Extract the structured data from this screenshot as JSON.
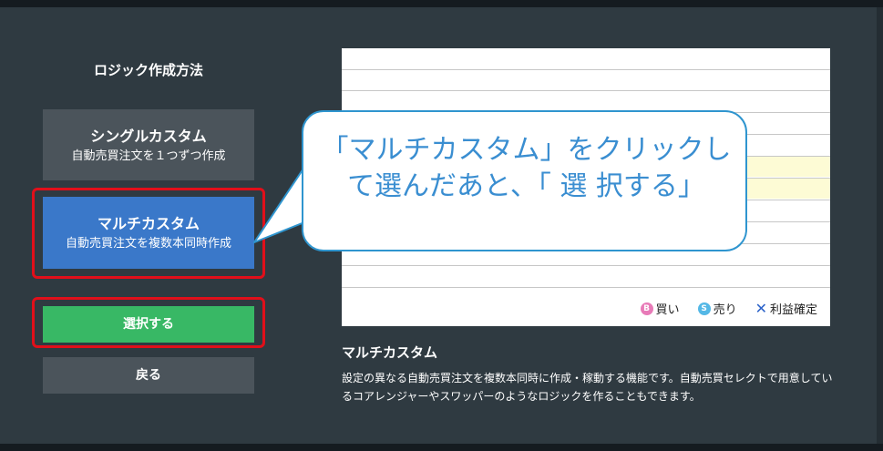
{
  "sidebar": {
    "heading": "ロジック作成方法",
    "options": [
      {
        "title": "シングルカスタム",
        "subtitle": "自動売買注文を１つずつ作成"
      },
      {
        "title": "マルチカスタム",
        "subtitle": "自動売買注文を複数本同時作成"
      }
    ],
    "select_label": "選択する",
    "back_label": "戻る"
  },
  "callout": {
    "line1": "「マルチカスタム」をクリックし",
    "line2": "て選んだあと、「 選 択する」"
  },
  "preview": {
    "legend": {
      "buy_icon": "B",
      "buy": "買い",
      "sell_icon": "S",
      "sell": "売り",
      "profit": "利益確定"
    }
  },
  "description": {
    "title": "マルチカスタム",
    "text": "設定の異なる自動売買注文を複数本同時に作成・稼動する機能です。自動売買セレクトで用意しているコアレンジャーやスワッパーのようなロジックを作ることもできます。"
  },
  "colors": {
    "panel": "#2f3a41",
    "selected_option": "#3a78c9",
    "select_button": "#38b865",
    "highlight": "#e10f1a",
    "callout_text": "#3a8ed1"
  }
}
